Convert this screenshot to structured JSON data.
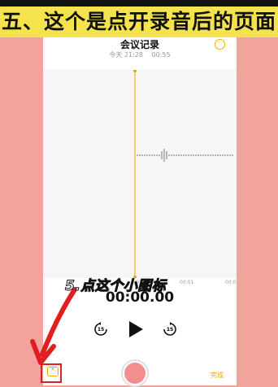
{
  "banner": {
    "text": "五、这个是点开录音后的页面"
  },
  "recording": {
    "title": "会议记录",
    "date": "今天 21:28",
    "duration": "00:55",
    "more_icon": "ellipsis-circle-icon"
  },
  "waveform": {
    "time_labels": [
      "00:00",
      "00:01",
      "00:0"
    ]
  },
  "timer": "00:00.00",
  "controls": {
    "skip_back_label": "15",
    "skip_forward_label": "15",
    "play_icon": "play-icon",
    "done_label": "完成"
  },
  "annotation": {
    "callout": "5.点这个小图标"
  },
  "colors": {
    "banner_bg": "#f4e34c",
    "outer_bg": "#f2a49c",
    "accent": "#e8a800",
    "record": "#f28e8e",
    "annotation_red": "#e02020"
  }
}
